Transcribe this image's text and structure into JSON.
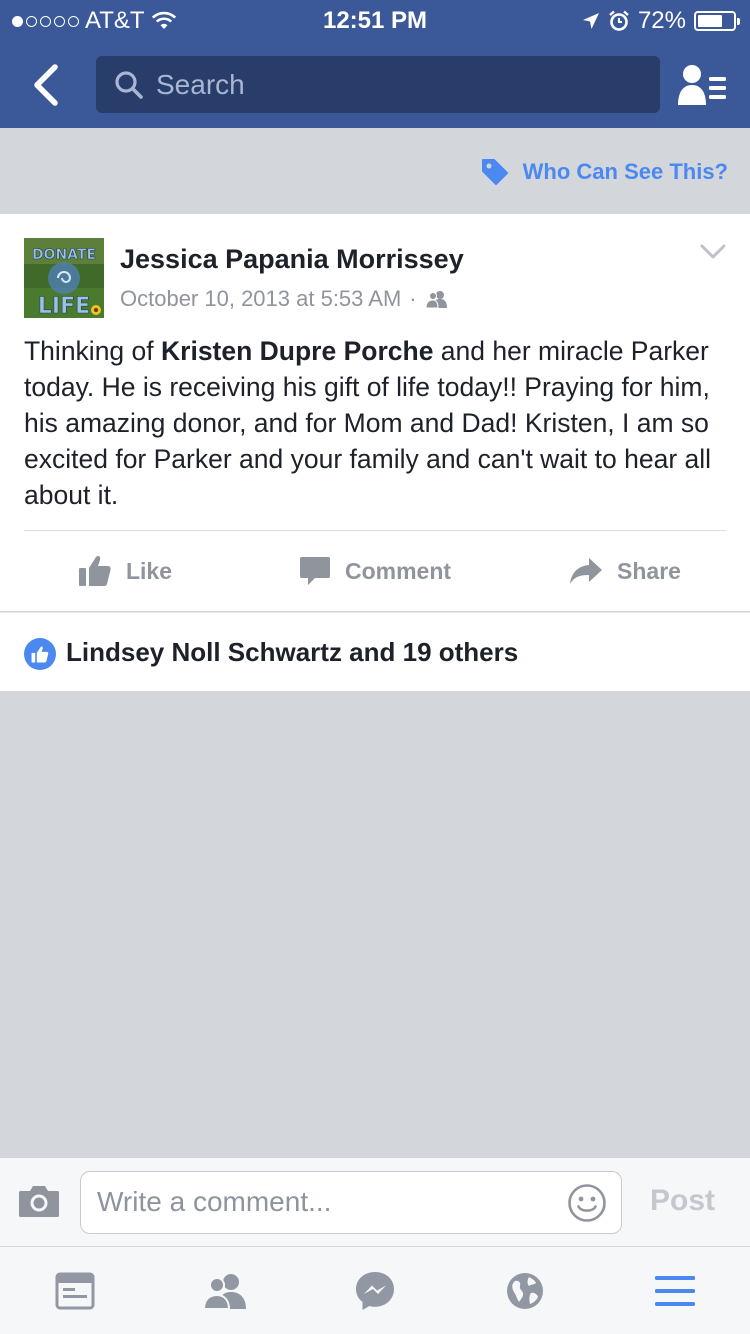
{
  "status_bar": {
    "carrier": "AT&T",
    "time": "12:51 PM",
    "battery_percent": "72%",
    "battery_level": 0.72
  },
  "nav": {
    "search_placeholder": "Search"
  },
  "privacy": {
    "label": "Who Can See This?"
  },
  "post": {
    "author": "Jessica Papania Morrissey",
    "timestamp": "October 10, 2013 at 5:53 AM",
    "separator": "·",
    "text_before": "Thinking of ",
    "tagged_name": "Kristen Dupre Porche",
    "text_after": " and her miracle Parker today. He is receiving his gift of life today!! Praying for him, his amazing donor, and for Mom and Dad!  Kristen, I am so excited for Parker and your family and can't wait to hear all about it.",
    "avatar_text_top": "DONATE",
    "avatar_text_bottom": "LIFE",
    "actions": {
      "like": "Like",
      "comment": "Comment",
      "share": "Share"
    }
  },
  "likes": {
    "summary": "Lindsey Noll Schwartz and 19 others"
  },
  "comment_bar": {
    "placeholder": "Write a comment...",
    "post_label": "Post"
  },
  "colors": {
    "brand_blue": "#3b5998",
    "link_blue": "#4b88f0",
    "muted_gray": "#90949c",
    "background": "#d3d6db"
  },
  "tabs": [
    "news-feed-icon",
    "friends-icon",
    "messenger-icon",
    "notifications-globe-icon",
    "menu-icon"
  ]
}
